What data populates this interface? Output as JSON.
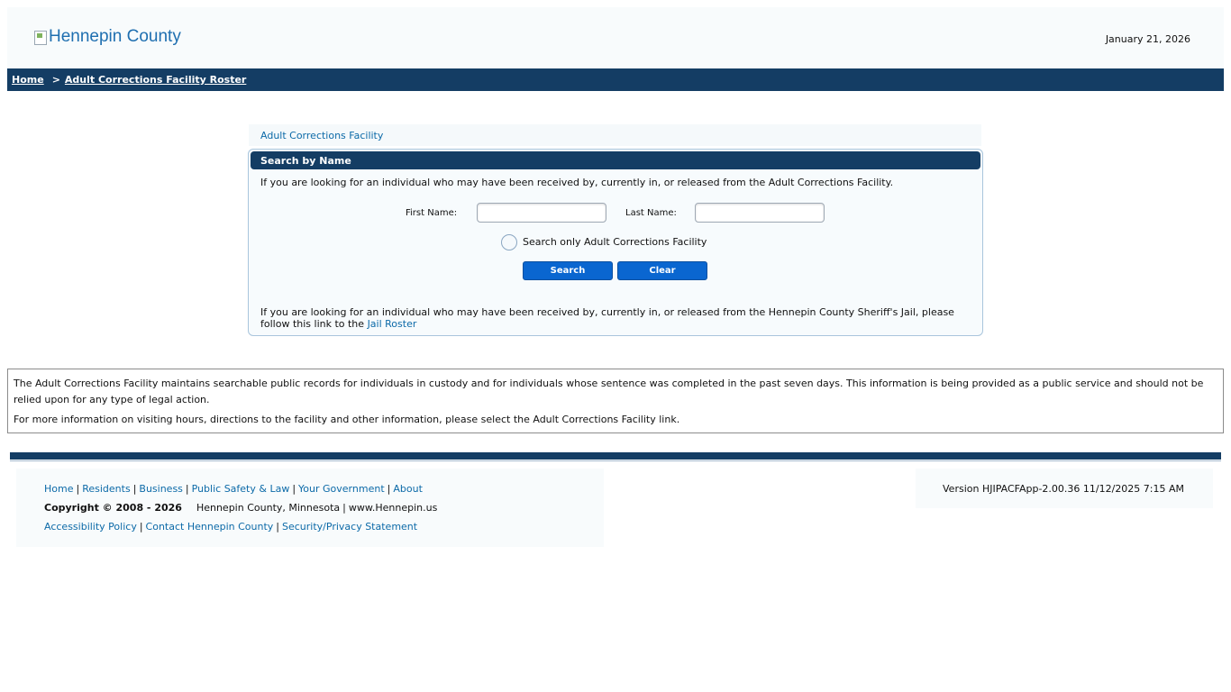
{
  "header": {
    "logo_alt": "Hennepin County",
    "date": "January 21, 2026"
  },
  "breadcrumb": {
    "home": "Home",
    "separator": ">",
    "current": "Adult Corrections Facility Roster"
  },
  "panel": {
    "title": "Adult Corrections Facility",
    "search": {
      "heading": "Search by Name",
      "description": "If you are looking for an individual who may have been received by, currently in, or released from the Adult Corrections Facility.",
      "first_name_label": "First Name:",
      "first_name_value": "",
      "last_name_label": "Last Name:",
      "last_name_value": "",
      "radio_label": "Search only Adult Corrections Facility",
      "search_button": "Search",
      "clear_button": "Clear",
      "footer_text": "If you are looking for an individual who may have been received by, currently in, or released from the Hennepin County Sheriff's Jail, please follow this link to the",
      "footer_link": "Jail Roster"
    }
  },
  "notice": {
    "p1": "The Adult Corrections Facility maintains searchable public records for individuals in custody and for individuals whose sentence was completed in the past seven days. This information is being provided as a public service and should not be relied upon for any type of legal action.",
    "p2": "For more information on visiting hours, directions to the facility and other information, please select the Adult Corrections Facility link."
  },
  "footer": {
    "links_row1": [
      "Home",
      "Residents",
      "Business",
      "Public Safety & Law",
      "Your Government",
      "About"
    ],
    "copyright": "Copyright © 2008 - 2026",
    "location": "Hennepin County, Minnesota",
    "website": "www.Hennepin.us",
    "links_row3": [
      "Accessibility Policy",
      "Contact Hennepin County",
      "Security/Privacy Statement"
    ],
    "version": "Version HJIPACFApp-2.00.36 11/12/2025 7:15 AM"
  },
  "colors": {
    "navy": "#143d64",
    "link": "#0c6aa8",
    "button": "#0a66d0"
  }
}
